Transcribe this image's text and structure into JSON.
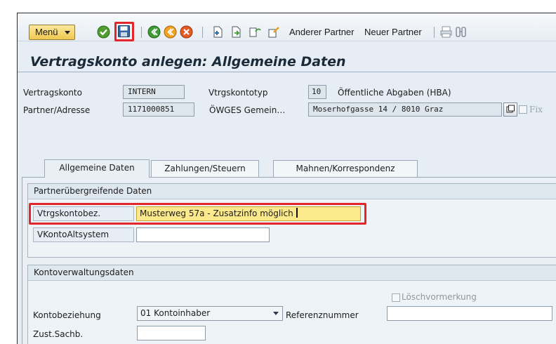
{
  "toolbar": {
    "menu_label": "Menü",
    "other_partner_label": "Anderer Partner",
    "new_partner_label": "Neuer Partner",
    "icons": [
      "check-icon",
      "save-icon",
      "back-icon",
      "exit-icon",
      "cancel-icon",
      "create-icon",
      "copy-icon",
      "display-icon",
      "change-icon",
      "print-icon",
      "find-icon"
    ]
  },
  "page": {
    "title": "Vertragskonto anlegen: Allgemeine Daten"
  },
  "header": {
    "contract_account_label": "Vertragskonto",
    "contract_account_value": "INTERN",
    "account_type_label": "Vtrgskontotyp",
    "account_type_code": "10",
    "account_type_text": "Öffentliche Abgaben (HBA)",
    "partner_label": "Partner/Adresse",
    "partner_value": "1171000851",
    "partner_name": "ÖWGES Gemein…",
    "address_value": "Moserhofgasse 14 / 8010 Graz",
    "fix_label": "Fix"
  },
  "tabs": [
    {
      "label": "Allgemeine Daten",
      "active": true
    },
    {
      "label": "Zahlungen/Steuern",
      "active": false
    },
    {
      "label": "Mahnen/Korrespondenz",
      "active": false
    }
  ],
  "partner_group": {
    "title": "Partnerübergreifende Daten",
    "description_label": "Vtrgskontobez.",
    "description_value": "Musterweg 57a - Zusatzinfo möglich",
    "legacy_label": "VKontoAltsystem",
    "legacy_value": ""
  },
  "account_group": {
    "title": "Kontoverwaltungsdaten",
    "deletion_flag_label": "Löschvormerkung",
    "relationship_label": "Kontobeziehung",
    "relationship_value": "01 Kontoinhaber",
    "reference_label": "Referenznummer",
    "reference_value": "",
    "clerk_label": "Zust.Sachb.",
    "clerk_value": ""
  },
  "colors": {
    "highlight": "#e3262b",
    "required_field": "#fce98c",
    "background": "#e6edf4"
  }
}
